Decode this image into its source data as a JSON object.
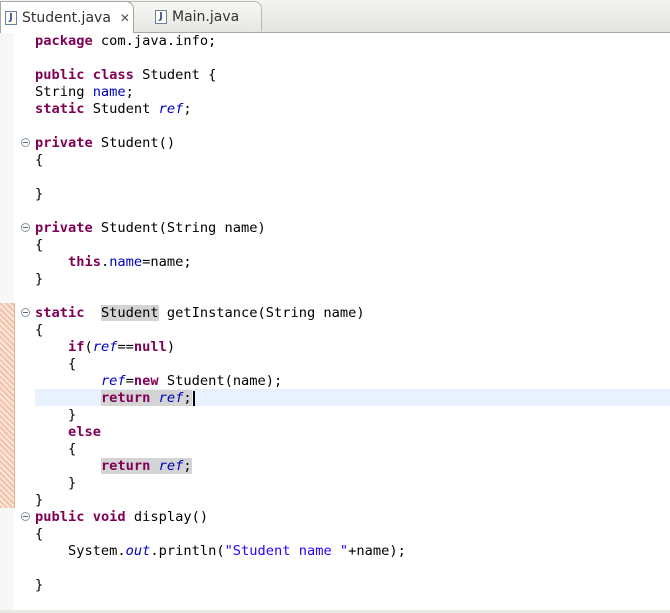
{
  "tabs": [
    {
      "label": "Student.java",
      "active": true
    },
    {
      "label": "Main.java",
      "active": false
    }
  ],
  "icons": {
    "java_file": "J",
    "close": "✕"
  },
  "colors": {
    "keyword": "#7f0055",
    "field": "#0000c0",
    "string": "#2a00ff",
    "current_line": "#e8f2fe",
    "occurrence": "#d4d4d4"
  },
  "editor": {
    "lines": {
      "l1_a": "package",
      "l1_b": " com.java.info;",
      "l3_a": "public",
      "l3_b": " ",
      "l3_c": "class",
      "l3_d": " Student {",
      "l4_a": "String ",
      "l4_b": "name",
      "l4_c": ";",
      "l5_a": "static",
      "l5_b": " Student ",
      "l5_c": "ref",
      "l5_d": ";",
      "l7_a": "private",
      "l7_b": " Student()",
      "l8": "{",
      "l10": "}",
      "l12_a": "private",
      "l12_b": " Student(String name)",
      "l13": "{",
      "l14_a": "    ",
      "l14_b": "this",
      "l14_c": ".",
      "l14_d": "name",
      "l14_e": "=name;",
      "l15": "}",
      "l17_a": "static",
      "l17_b": "  ",
      "l17_c": "Student",
      "l17_d": " getInstance(String name)",
      "l18": "{",
      "l19_a": "    ",
      "l19_b": "if",
      "l19_c": "(",
      "l19_d": "ref",
      "l19_e": "==",
      "l19_f": "null",
      "l19_g": ")",
      "l20": "    {",
      "l21_a": "        ",
      "l21_b": "ref",
      "l21_c": "=",
      "l21_d": "new",
      "l21_e": " Student(name);",
      "l22_a": "        ",
      "l22_b": "return",
      "l22_c": " ",
      "l22_d": "ref",
      "l22_e": ";",
      "l23": "    }",
      "l24_a": "    ",
      "l24_b": "else",
      "l25": "    {",
      "l26_a": "        ",
      "l26_b": "return",
      "l26_c": " ",
      "l26_d": "ref",
      "l26_e": ";",
      "l27": "    }",
      "l28": "}",
      "l29_a": "public",
      "l29_b": " ",
      "l29_c": "void",
      "l29_d": " display()",
      "l30": "{",
      "l31_a": "    System.",
      "l31_b": "out",
      "l31_c": ".println(",
      "l31_d": "\"Student name \"",
      "l31_e": "+name);",
      "l33": "}"
    }
  }
}
